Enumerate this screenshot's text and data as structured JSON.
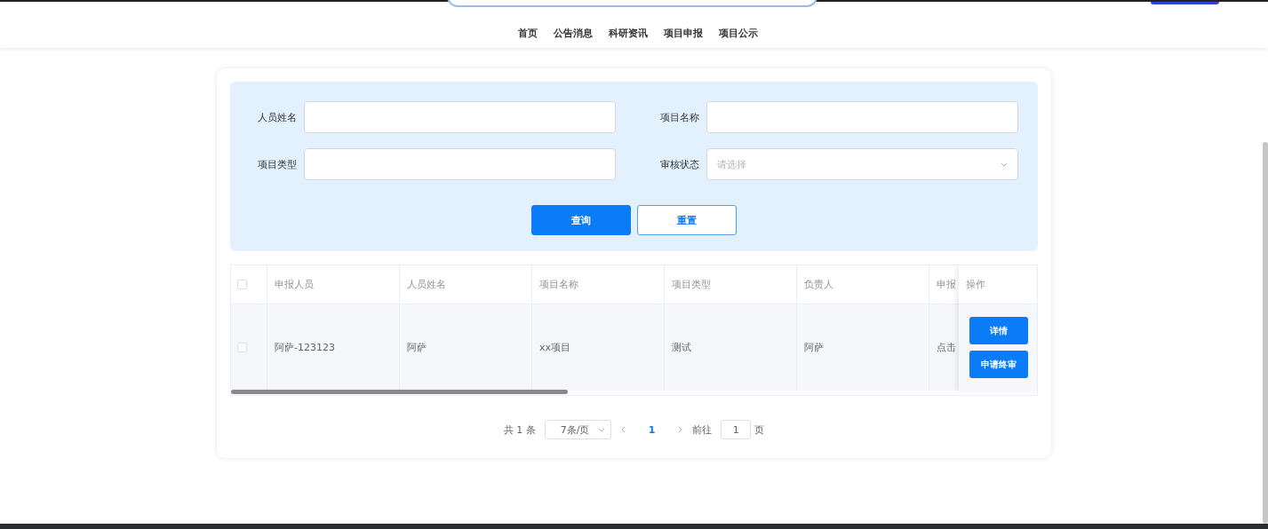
{
  "header": {
    "nav": [
      {
        "label": "首页"
      },
      {
        "label": "公告消息"
      },
      {
        "label": "科研资讯"
      },
      {
        "label": "项目申报"
      },
      {
        "label": "项目公示"
      }
    ]
  },
  "filters": [
    {
      "label": "人员姓名",
      "kind": "input"
    },
    {
      "label": "项目名称",
      "kind": "input"
    },
    {
      "label": "项目类型",
      "kind": "input"
    },
    {
      "label": "审核状态",
      "kind": "select",
      "placeholder": "请选择"
    }
  ],
  "buttons": [
    {
      "label": "查询",
      "kind": "primary"
    },
    {
      "label": "重置",
      "kind": "plain"
    }
  ],
  "table": {
    "select_all_checked": false,
    "columns": [
      "申报人员",
      "人员姓名",
      "项目名称",
      "项目类型",
      "负责人",
      "申报"
    ],
    "action_column": "操作",
    "rows": [
      {
        "checked": false,
        "cells": [
          "阿萨-123123",
          "阿萨",
          "xx项目",
          "测试",
          "阿萨",
          "点击"
        ],
        "actions": [
          "详情",
          "申请终审"
        ]
      }
    ]
  },
  "pagination": {
    "total": "共 1 条",
    "page_size": "7条/页",
    "pages": [
      {
        "label": "1",
        "selected": true
      }
    ],
    "goto_label": "前往",
    "goto_value": "1",
    "goto_suffix": "页"
  }
}
